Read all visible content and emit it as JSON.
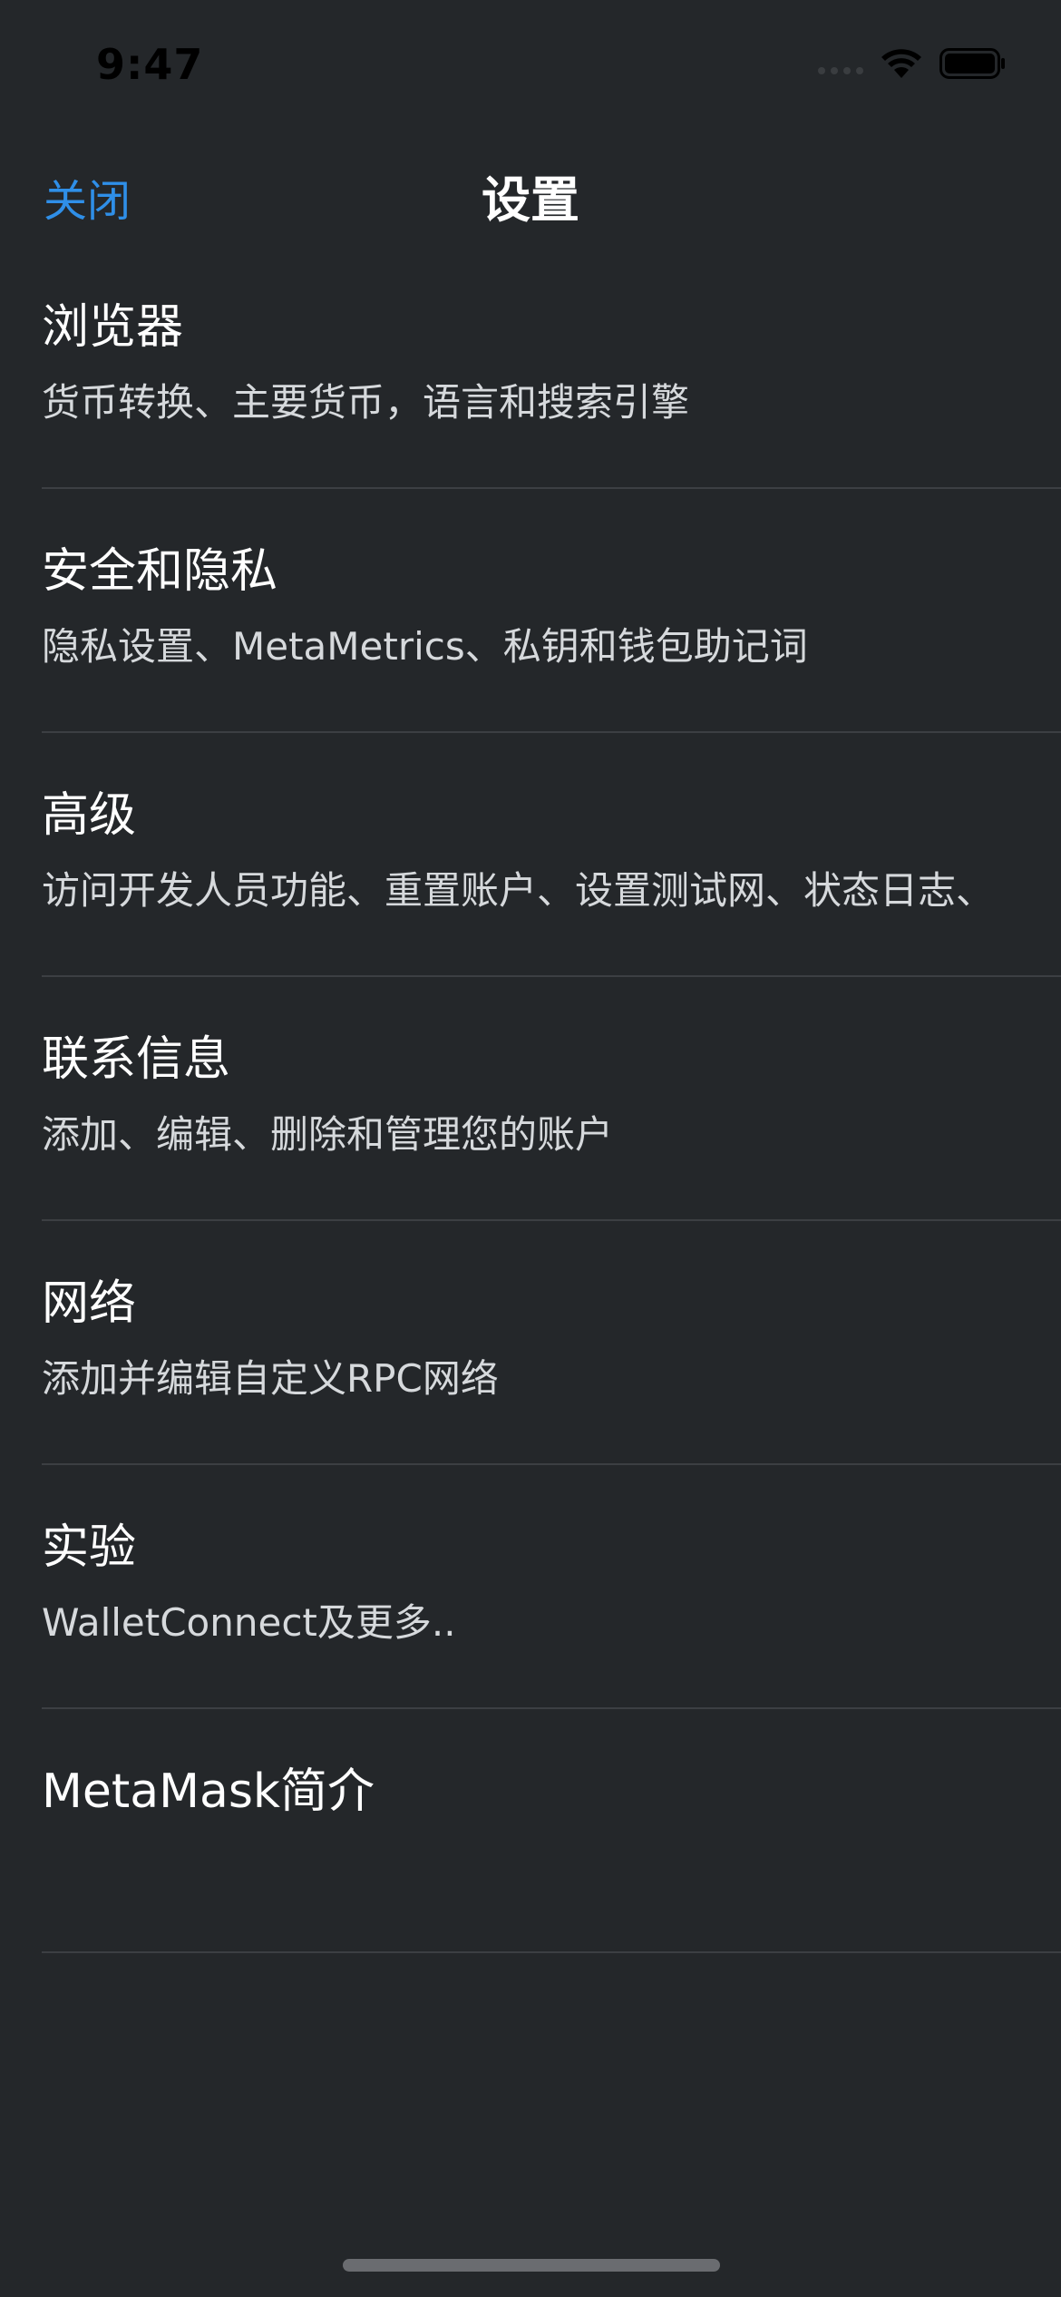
{
  "status_bar": {
    "time": "9:47",
    "signal_icon": "signal-dots-icon",
    "wifi_icon": "wifi-icon",
    "battery_icon": "battery-icon"
  },
  "nav": {
    "close_label": "关闭",
    "title": "设置"
  },
  "settings": {
    "items": [
      {
        "title": "浏览器",
        "description": "货币转换、主要货币，语言和搜索引擎"
      },
      {
        "title": "安全和隐私",
        "description": "隐私设置、MetaMetrics、私钥和钱包助记词"
      },
      {
        "title": "高级",
        "description": "访问开发人员功能、重置账户、设置测试网、状态日志、"
      },
      {
        "title": "联系信息",
        "description": "添加、编辑、删除和管理您的账户"
      },
      {
        "title": "网络",
        "description": "添加并编辑自定义RPC网络"
      },
      {
        "title": "实验",
        "description": "WalletConnect及更多.."
      },
      {
        "title": "MetaMask简介",
        "description": ""
      }
    ]
  },
  "colors": {
    "background": "#24272a",
    "accent": "#2f8fe8",
    "divider": "#3c3f43",
    "text_primary": "#ffffff",
    "text_secondary": "#d6d9dc"
  }
}
